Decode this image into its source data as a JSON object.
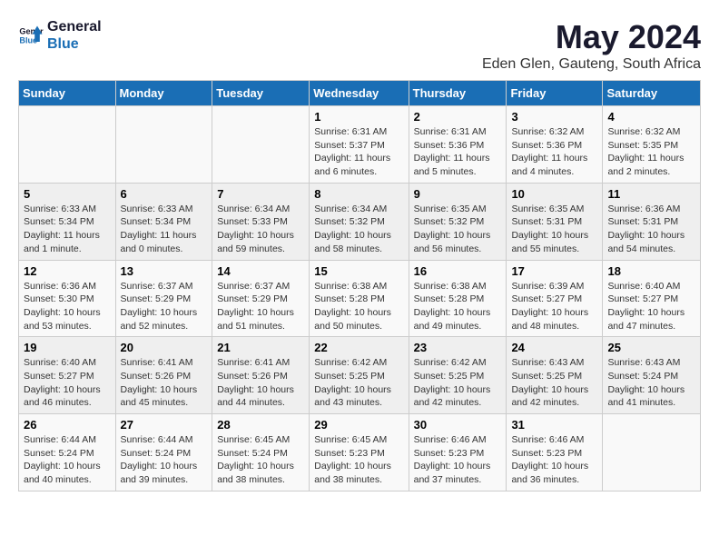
{
  "logo": {
    "line1": "General",
    "line2": "Blue"
  },
  "title": "May 2024",
  "subtitle": "Eden Glen, Gauteng, South Africa",
  "days_of_week": [
    "Sunday",
    "Monday",
    "Tuesday",
    "Wednesday",
    "Thursday",
    "Friday",
    "Saturday"
  ],
  "weeks": [
    [
      {
        "day": "",
        "info": ""
      },
      {
        "day": "",
        "info": ""
      },
      {
        "day": "",
        "info": ""
      },
      {
        "day": "1",
        "info": "Sunrise: 6:31 AM\nSunset: 5:37 PM\nDaylight: 11 hours and 6 minutes."
      },
      {
        "day": "2",
        "info": "Sunrise: 6:31 AM\nSunset: 5:36 PM\nDaylight: 11 hours and 5 minutes."
      },
      {
        "day": "3",
        "info": "Sunrise: 6:32 AM\nSunset: 5:36 PM\nDaylight: 11 hours and 4 minutes."
      },
      {
        "day": "4",
        "info": "Sunrise: 6:32 AM\nSunset: 5:35 PM\nDaylight: 11 hours and 2 minutes."
      }
    ],
    [
      {
        "day": "5",
        "info": "Sunrise: 6:33 AM\nSunset: 5:34 PM\nDaylight: 11 hours and 1 minute."
      },
      {
        "day": "6",
        "info": "Sunrise: 6:33 AM\nSunset: 5:34 PM\nDaylight: 11 hours and 0 minutes."
      },
      {
        "day": "7",
        "info": "Sunrise: 6:34 AM\nSunset: 5:33 PM\nDaylight: 10 hours and 59 minutes."
      },
      {
        "day": "8",
        "info": "Sunrise: 6:34 AM\nSunset: 5:32 PM\nDaylight: 10 hours and 58 minutes."
      },
      {
        "day": "9",
        "info": "Sunrise: 6:35 AM\nSunset: 5:32 PM\nDaylight: 10 hours and 56 minutes."
      },
      {
        "day": "10",
        "info": "Sunrise: 6:35 AM\nSunset: 5:31 PM\nDaylight: 10 hours and 55 minutes."
      },
      {
        "day": "11",
        "info": "Sunrise: 6:36 AM\nSunset: 5:31 PM\nDaylight: 10 hours and 54 minutes."
      }
    ],
    [
      {
        "day": "12",
        "info": "Sunrise: 6:36 AM\nSunset: 5:30 PM\nDaylight: 10 hours and 53 minutes."
      },
      {
        "day": "13",
        "info": "Sunrise: 6:37 AM\nSunset: 5:29 PM\nDaylight: 10 hours and 52 minutes."
      },
      {
        "day": "14",
        "info": "Sunrise: 6:37 AM\nSunset: 5:29 PM\nDaylight: 10 hours and 51 minutes."
      },
      {
        "day": "15",
        "info": "Sunrise: 6:38 AM\nSunset: 5:28 PM\nDaylight: 10 hours and 50 minutes."
      },
      {
        "day": "16",
        "info": "Sunrise: 6:38 AM\nSunset: 5:28 PM\nDaylight: 10 hours and 49 minutes."
      },
      {
        "day": "17",
        "info": "Sunrise: 6:39 AM\nSunset: 5:27 PM\nDaylight: 10 hours and 48 minutes."
      },
      {
        "day": "18",
        "info": "Sunrise: 6:40 AM\nSunset: 5:27 PM\nDaylight: 10 hours and 47 minutes."
      }
    ],
    [
      {
        "day": "19",
        "info": "Sunrise: 6:40 AM\nSunset: 5:27 PM\nDaylight: 10 hours and 46 minutes."
      },
      {
        "day": "20",
        "info": "Sunrise: 6:41 AM\nSunset: 5:26 PM\nDaylight: 10 hours and 45 minutes."
      },
      {
        "day": "21",
        "info": "Sunrise: 6:41 AM\nSunset: 5:26 PM\nDaylight: 10 hours and 44 minutes."
      },
      {
        "day": "22",
        "info": "Sunrise: 6:42 AM\nSunset: 5:25 PM\nDaylight: 10 hours and 43 minutes."
      },
      {
        "day": "23",
        "info": "Sunrise: 6:42 AM\nSunset: 5:25 PM\nDaylight: 10 hours and 42 minutes."
      },
      {
        "day": "24",
        "info": "Sunrise: 6:43 AM\nSunset: 5:25 PM\nDaylight: 10 hours and 42 minutes."
      },
      {
        "day": "25",
        "info": "Sunrise: 6:43 AM\nSunset: 5:24 PM\nDaylight: 10 hours and 41 minutes."
      }
    ],
    [
      {
        "day": "26",
        "info": "Sunrise: 6:44 AM\nSunset: 5:24 PM\nDaylight: 10 hours and 40 minutes."
      },
      {
        "day": "27",
        "info": "Sunrise: 6:44 AM\nSunset: 5:24 PM\nDaylight: 10 hours and 39 minutes."
      },
      {
        "day": "28",
        "info": "Sunrise: 6:45 AM\nSunset: 5:24 PM\nDaylight: 10 hours and 38 minutes."
      },
      {
        "day": "29",
        "info": "Sunrise: 6:45 AM\nSunset: 5:23 PM\nDaylight: 10 hours and 38 minutes."
      },
      {
        "day": "30",
        "info": "Sunrise: 6:46 AM\nSunset: 5:23 PM\nDaylight: 10 hours and 37 minutes."
      },
      {
        "day": "31",
        "info": "Sunrise: 6:46 AM\nSunset: 5:23 PM\nDaylight: 10 hours and 36 minutes."
      },
      {
        "day": "",
        "info": ""
      }
    ]
  ]
}
